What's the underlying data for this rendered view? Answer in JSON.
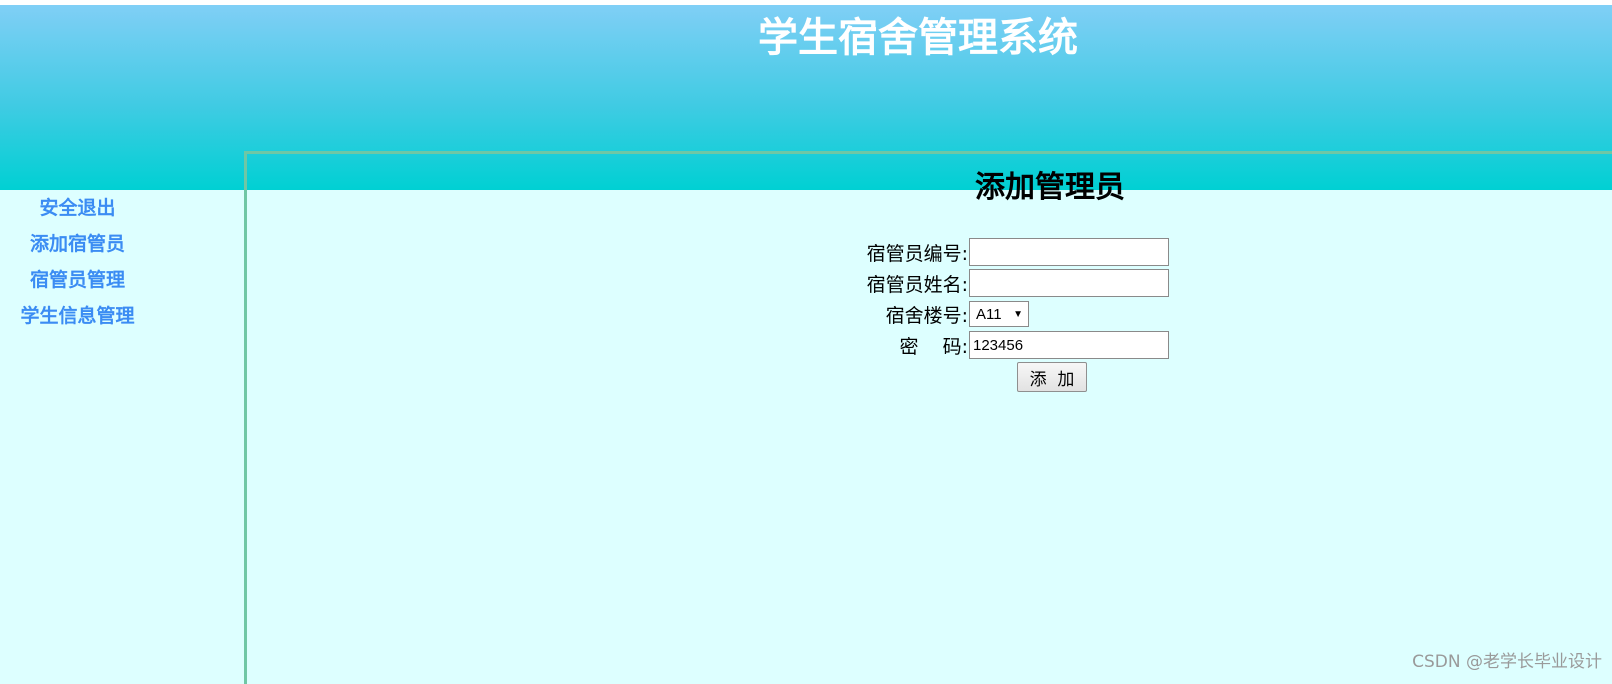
{
  "header": {
    "title": "学生宿舍管理系统"
  },
  "sidebar": {
    "items": [
      {
        "label": "安全退出"
      },
      {
        "label": "添加宿管员"
      },
      {
        "label": "宿管员管理"
      },
      {
        "label": "学生信息管理"
      }
    ]
  },
  "form": {
    "title": "添加管理员",
    "fields": {
      "id": {
        "label": "宿管员编号:",
        "value": ""
      },
      "name": {
        "label": "宿管员姓名:",
        "value": ""
      },
      "building": {
        "label": "宿舍楼号:",
        "value": "A11"
      },
      "password": {
        "label": "密    码:",
        "value": "123456"
      }
    },
    "submit_label": "添  加"
  },
  "watermark": "CSDN @老学长毕业设计",
  "colors": {
    "header_top": "#80cff6",
    "header_bottom": "#00d0d3",
    "page_bg": "#ddffff",
    "sidebar_link": "#3b8cf3",
    "frame_border": "#6fc7a5"
  }
}
